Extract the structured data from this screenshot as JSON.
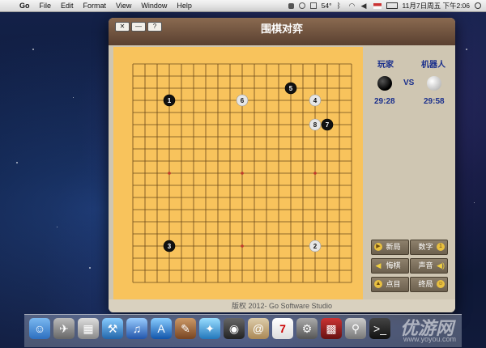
{
  "menubar": {
    "app": "Go",
    "items": [
      "File",
      "Edit",
      "Format",
      "View",
      "Window",
      "Help"
    ],
    "battery": "54°",
    "clock": "11月7日周五 下午2:06"
  },
  "window": {
    "title": "围棋对弈",
    "controls": [
      "✕",
      "—",
      "?"
    ],
    "footer": "版权 2012- Go Software Studio"
  },
  "players": {
    "human_label": "玩家",
    "vs": "VS",
    "robot_label": "机器人",
    "human_time": "29:28",
    "robot_time": "29:58"
  },
  "buttons": {
    "new_game": "新局",
    "numbers": "数字",
    "undo": "悔棋",
    "sound": "声音",
    "count": "点目",
    "end": "终局"
  },
  "stones": [
    {
      "n": "1",
      "color": "black",
      "col": 3,
      "row": 3
    },
    {
      "n": "2",
      "color": "white",
      "col": 15,
      "row": 15
    },
    {
      "n": "3",
      "color": "black",
      "col": 3,
      "row": 15
    },
    {
      "n": "4",
      "color": "white",
      "col": 15,
      "row": 3
    },
    {
      "n": "5",
      "color": "black",
      "col": 13,
      "row": 2
    },
    {
      "n": "6",
      "color": "white",
      "col": 9,
      "row": 3
    },
    {
      "n": "7",
      "color": "black",
      "col": 16,
      "row": 5
    },
    {
      "n": "8",
      "color": "white",
      "col": 15,
      "row": 5
    }
  ],
  "watermark": "优游网",
  "watermark_url": "www.yoyou.com"
}
